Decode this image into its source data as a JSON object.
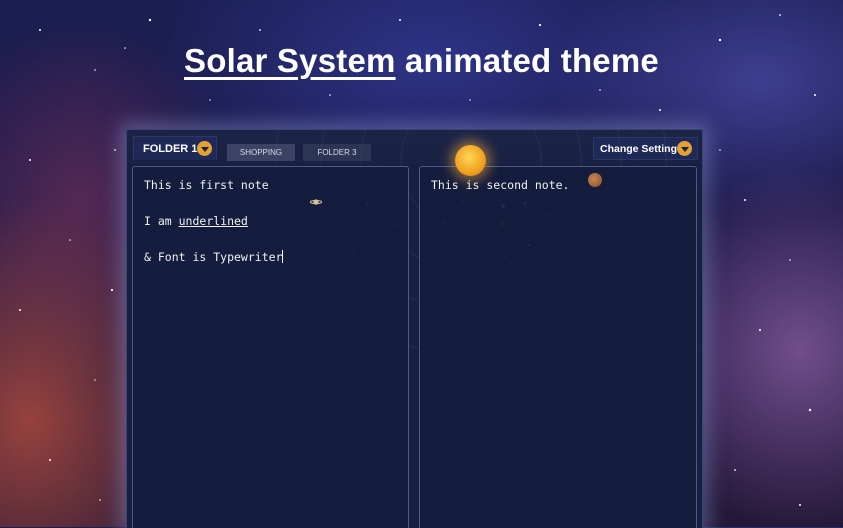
{
  "headline": {
    "underlined": "Solar System",
    "rest": " animated theme"
  },
  "tabs": {
    "active": "FOLDER 1",
    "others": [
      "SHOPPING",
      "FOLDER 3"
    ]
  },
  "settings_label": "Change Settings",
  "notes": [
    {
      "line1": "This is first note",
      "line2_prefix": "I am ",
      "line2_underlined": "underlined",
      "line3": "& Font is Typewriter"
    },
    {
      "line1": "This is second note."
    }
  ],
  "colors": {
    "accent": "#e3a233",
    "panel": "#162043"
  },
  "icons": {
    "folder_dropdown": "chevron-down-icon",
    "settings_dropdown": "chevron-down-icon"
  }
}
